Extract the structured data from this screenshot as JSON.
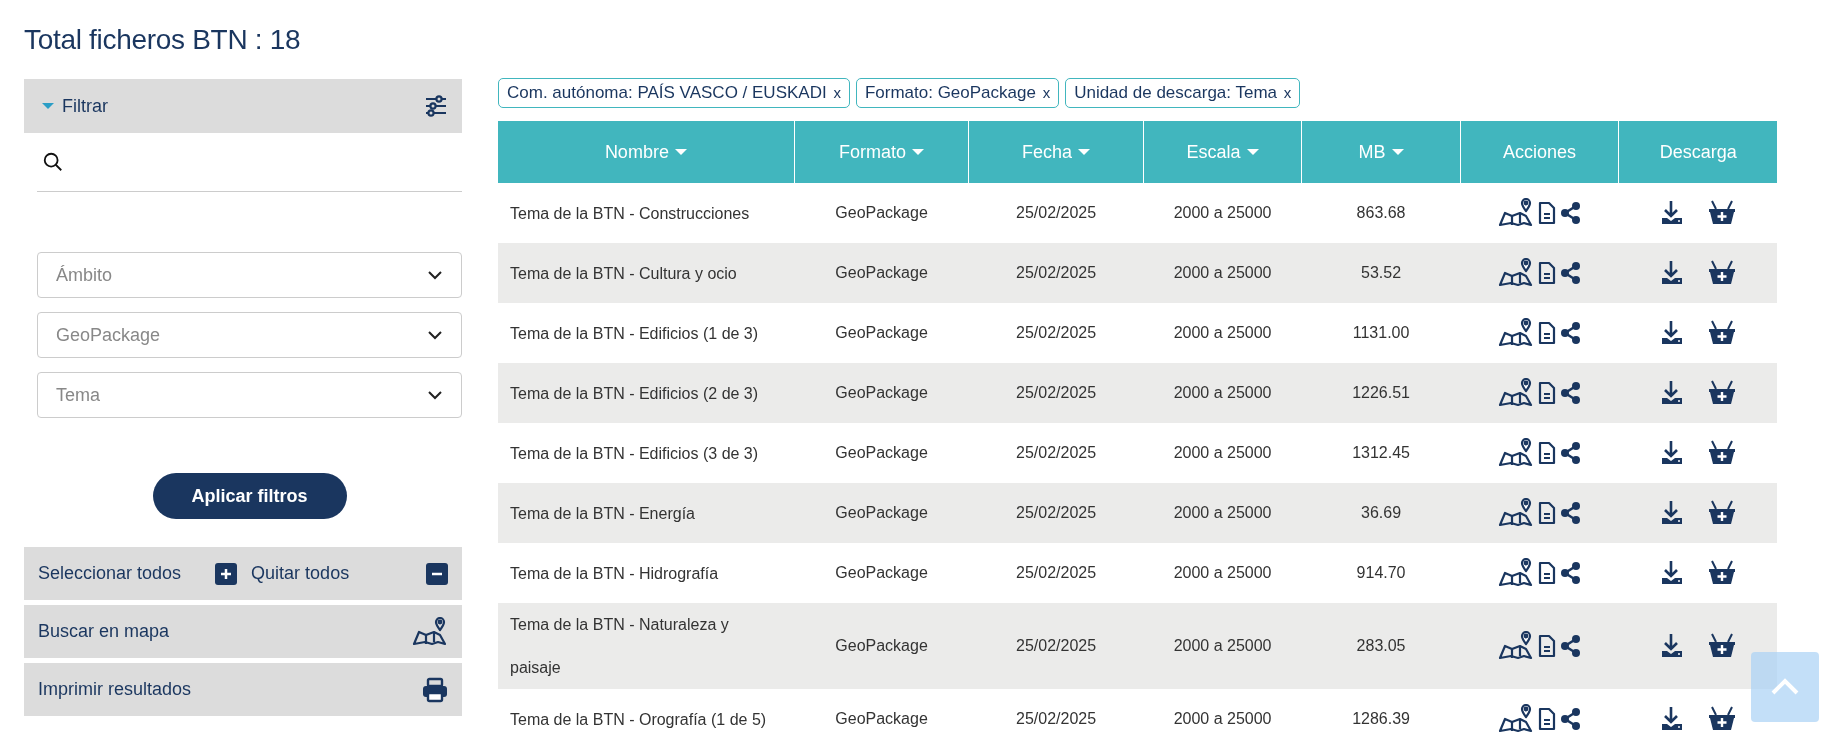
{
  "title": "Total ficheros BTN : 18",
  "filter": {
    "label": "Filtrar",
    "expanded": true,
    "selects": [
      {
        "label": "Ámbito"
      },
      {
        "label": "GeoPackage"
      },
      {
        "label": "Tema"
      }
    ],
    "apply_button": "Aplicar filtros"
  },
  "bulk": {
    "select_all": "Seleccionar todos",
    "remove_all": "Quitar todos"
  },
  "actions": [
    {
      "kind": "map",
      "label": "Buscar en mapa"
    },
    {
      "kind": "print",
      "label": "Imprimir resultados"
    }
  ],
  "chips": [
    {
      "label": "Com. autónoma: PAÍS VASCO / EUSKADI",
      "close": "x"
    },
    {
      "label": "Formato: GeoPackage",
      "close": "x"
    },
    {
      "label": "Unidad de descarga: Tema",
      "close": "x"
    }
  ],
  "table": {
    "columns": [
      {
        "label": "Nombre",
        "sortable": true
      },
      {
        "label": "Formato",
        "sortable": true
      },
      {
        "label": "Fecha",
        "sortable": true
      },
      {
        "label": "Escala",
        "sortable": true
      },
      {
        "label": "MB",
        "sortable": true
      },
      {
        "label": "Acciones",
        "sortable": false
      },
      {
        "label": "Descarga",
        "sortable": false
      }
    ],
    "rows": [
      {
        "name": "Tema de la BTN - Construcciones",
        "format": "GeoPackage",
        "date": "25/02/2025",
        "scale": "2000 a 25000",
        "mb": "863.68"
      },
      {
        "name": "Tema de la BTN - Cultura y ocio",
        "format": "GeoPackage",
        "date": "25/02/2025",
        "scale": "2000 a 25000",
        "mb": "53.52"
      },
      {
        "name": "Tema de la BTN - Edificios (1 de 3)",
        "format": "GeoPackage",
        "date": "25/02/2025",
        "scale": "2000 a 25000",
        "mb": "1131.00"
      },
      {
        "name": "Tema de la BTN - Edificios (2 de 3)",
        "format": "GeoPackage",
        "date": "25/02/2025",
        "scale": "2000 a 25000",
        "mb": "1226.51"
      },
      {
        "name": "Tema de la BTN - Edificios (3 de 3)",
        "format": "GeoPackage",
        "date": "25/02/2025",
        "scale": "2000 a 25000",
        "mb": "1312.45"
      },
      {
        "name": "Tema de la BTN - Energía",
        "format": "GeoPackage",
        "date": "25/02/2025",
        "scale": "2000 a 25000",
        "mb": "36.69"
      },
      {
        "name": "Tema de la BTN - Hidrografía",
        "format": "GeoPackage",
        "date": "25/02/2025",
        "scale": "2000 a 25000",
        "mb": "914.70"
      },
      {
        "name": "Tema de la BTN - Naturaleza y paisaje",
        "format": "GeoPackage",
        "date": "25/02/2025",
        "scale": "2000 a 25000",
        "mb": "283.05"
      },
      {
        "name": "Tema de la BTN - Orografía (1 de 5)",
        "format": "GeoPackage",
        "date": "25/02/2025",
        "scale": "2000 a 25000",
        "mb": "1286.39"
      }
    ]
  }
}
